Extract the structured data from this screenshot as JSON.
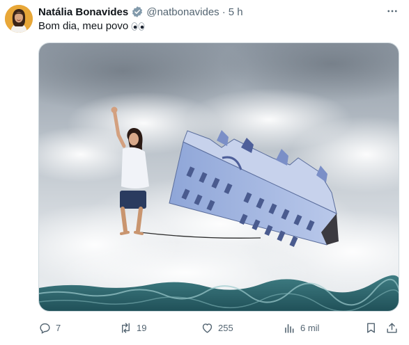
{
  "tweet": {
    "author_name": "Natália Bonavides",
    "handle": "@natbonavides",
    "separator": "·",
    "time": "5 h",
    "text": "Bom dia, meu povo"
  },
  "actions": {
    "replies": "7",
    "reposts": "19",
    "likes": "255",
    "views": "6 mil"
  },
  "icons": {
    "verified": "verified-badge-icon",
    "more": "more-icon",
    "eyes": "eyes-emoji",
    "reply": "reply-icon",
    "repost": "repost-icon",
    "like": "heart-icon",
    "views": "analytics-icon",
    "bookmark": "bookmark-icon",
    "share": "share-icon"
  },
  "colors": {
    "verified": "#829aab",
    "text_secondary": "#536471",
    "text_primary": "#0f1419"
  }
}
